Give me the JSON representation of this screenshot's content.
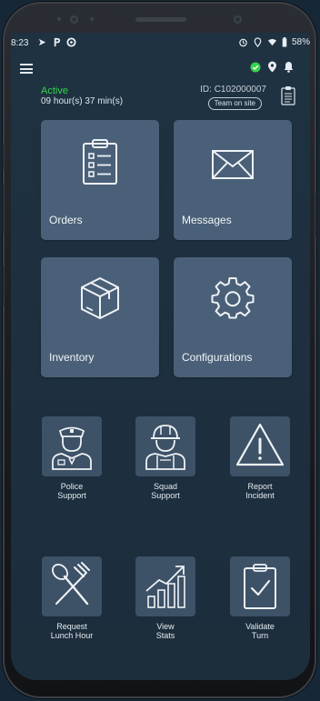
{
  "status_bar": {
    "time": "8:23",
    "battery": "58%",
    "left_icons": [
      "navigation-icon",
      "parking-icon",
      "sync-icon"
    ],
    "right_icons": [
      "alarm-icon",
      "location-icon",
      "wifi-icon",
      "battery-icon"
    ]
  },
  "header": {
    "menu_icon": "hamburger-icon",
    "icons": [
      "check-circle-icon",
      "location-pin-icon",
      "bell-icon"
    ]
  },
  "shift": {
    "status": "Active",
    "duration": "09 hour(s) 37 min(s)",
    "device_id": "ID: C102000007",
    "team_status": "Team on site"
  },
  "tiles": [
    {
      "label": "Orders",
      "icon": "clipboard-list-icon"
    },
    {
      "label": "Messages",
      "icon": "envelope-icon"
    },
    {
      "label": "Inventory",
      "icon": "package-icon"
    },
    {
      "label": "Configurations",
      "icon": "gear-icon"
    }
  ],
  "actions": [
    {
      "label_lines": [
        "Police",
        "Support"
      ],
      "icon": "police-officer-icon"
    },
    {
      "label_lines": [
        "Squad",
        "Support"
      ],
      "icon": "construction-worker-icon"
    },
    {
      "label_lines": [
        "Report",
        "Incident"
      ],
      "icon": "warning-triangle-icon"
    },
    {
      "label_lines": [
        "Request",
        "Lunch Hour"
      ],
      "icon": "utensils-icon"
    },
    {
      "label_lines": [
        "View",
        "Stats"
      ],
      "icon": "chart-growth-icon"
    },
    {
      "label_lines": [
        "Validate",
        "Turn"
      ],
      "icon": "clipboard-check-icon"
    }
  ],
  "colors": {
    "active": "#35d24a",
    "tile_bg": "#4a6078",
    "button_bg": "#3d5167",
    "screen_bg": "#1e3040"
  }
}
